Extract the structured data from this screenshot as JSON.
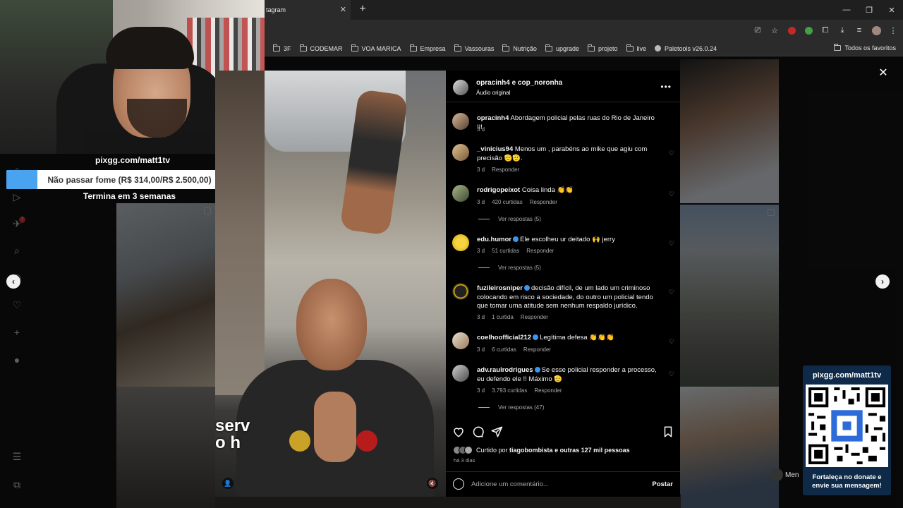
{
  "browser": {
    "tab_title": "tagram",
    "tab_close": "✕",
    "new_tab": "+",
    "window_controls": [
      "—",
      "❐",
      "✕"
    ],
    "bookmarks": [
      "3F",
      "CODEMAR",
      "VOA MARICA",
      "Empresa",
      "Vassouras",
      "Nutrição",
      "upgrade",
      "projeto",
      "live"
    ],
    "palettools": "Paletools v26.0.24",
    "all_bookmarks": "Todos os favoritos"
  },
  "donation": {
    "url": "pixgg.com/matt1tv",
    "goal": "Não passar fome (R$ 314,00/R$ 2.500,00)",
    "goal_progress": 0.1256,
    "ends": "Termina em 3 semanas"
  },
  "video": {
    "caption_overlay": "serv\no h"
  },
  "post": {
    "authors": "opracinh4 e cop_noronha",
    "audio": "Áudio original",
    "more": "•••",
    "comments": [
      {
        "user": "opracinh4",
        "text": "Abordagem policial pelas ruas do Rio de Janeiro !!!",
        "time": "3 d",
        "likes": "",
        "reply": "",
        "verified": false
      },
      {
        "user": "_vinicius94",
        "text": "Menos um , parabéns ao mike que agiu com precisão 🫡🫡.",
        "time": "3 d",
        "likes": "",
        "reply": "Responder",
        "verified": false
      },
      {
        "user": "rodrigopeixot",
        "text": "Coisa linda 👏👏",
        "time": "3 d",
        "likes": "420 curtidas",
        "reply": "Responder",
        "verified": false,
        "replies": "Ver respostas (5)"
      },
      {
        "user": "edu.humor",
        "text": "Ele escolheu ur deitado 🙌 jerry",
        "time": "3 d",
        "likes": "51 curtidas",
        "reply": "Responder",
        "verified": true,
        "replies": "Ver respostas (5)"
      },
      {
        "user": "fuzileirosniper",
        "text": "decisão difícil, de um lado um criminoso colocando em risco a sociedade, do outro um policial tendo que tomar uma atitude sem nenhum respaldo jurídico.",
        "time": "3 d",
        "likes": "1 curtida",
        "reply": "Responder",
        "verified": true
      },
      {
        "user": "coelhoofficial212",
        "text": "Legítima defesa 👏👏👏",
        "time": "3 d",
        "likes": "6 curtidas",
        "reply": "Responder",
        "verified": true
      },
      {
        "user": "adv.raulrodrigues",
        "text": "Se esse policial responder a processo, eu defendo ele !! Máximo 🫡",
        "time": "3 d",
        "likes": "3.793 curtidas",
        "reply": "Responder",
        "verified": true,
        "replies": "Ver respostas (47)"
      }
    ],
    "liked_prefix": "Curtido por",
    "liked_user": "tiagobombista",
    "liked_suffix": "e outras 127 mil pessoas",
    "when": "há 3 dias",
    "add_comment_placeholder": "Adicione um comentário...",
    "post_button": "Postar"
  },
  "qr_widget": {
    "url": "pixgg.com/matt1tv",
    "message": "Fortaleça no donate e envie sua mensagem!"
  },
  "messages_chip": "Men",
  "colors": {
    "accent": "#3897f0",
    "donation_fill": "#4aa3ef",
    "qr_bg": "#0e2a48"
  }
}
